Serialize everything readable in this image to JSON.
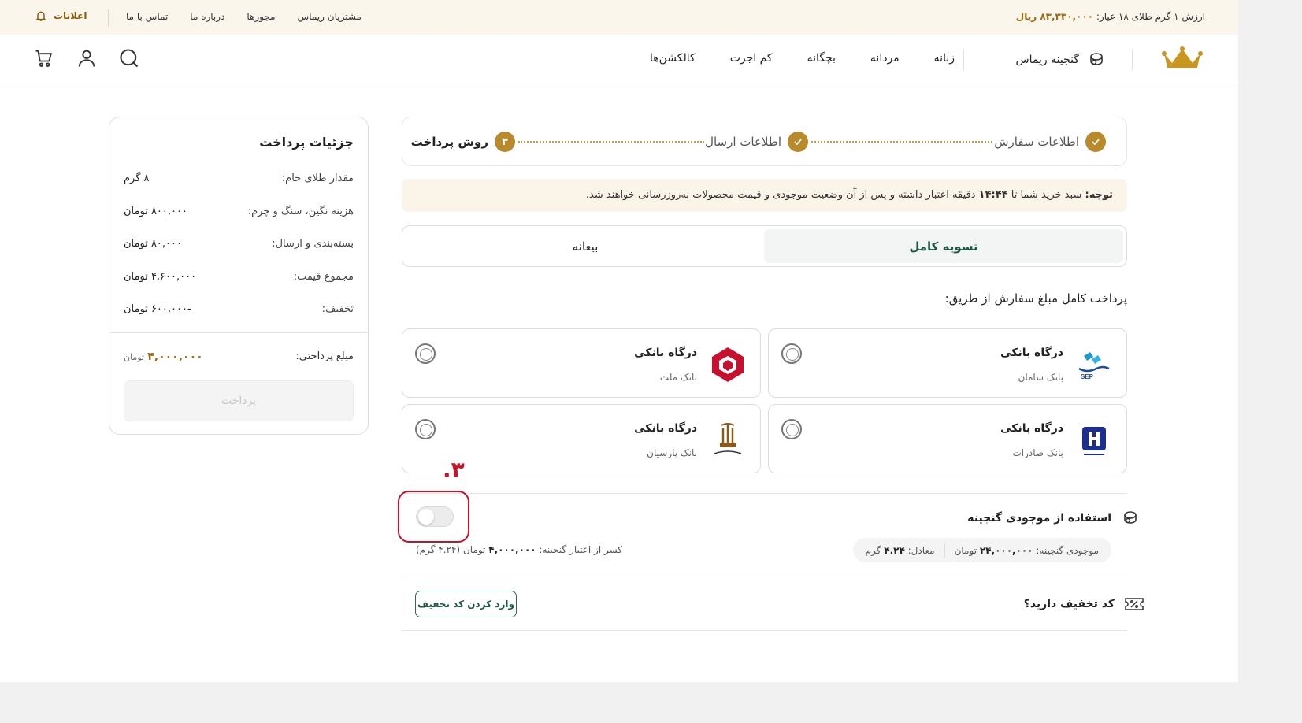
{
  "topbar": {
    "gold_price_label": "ارزش ۱ گرم طلای ۱۸ عیار:",
    "gold_price_value": "۸۳,۳۳۰,۰۰۰ ریال",
    "links": [
      "مشتریان ریماس",
      "مجوزها",
      "درباره ما",
      "تماس با ما"
    ],
    "notifications": "اعلانات"
  },
  "header": {
    "ganjine": "گنجینه ریماس",
    "nav": [
      "زنانه",
      "مردانه",
      "بچگانه",
      "کم اجرت",
      "کالکشن‌ها"
    ]
  },
  "details": {
    "title": "جزئیات پرداخت",
    "rows": [
      {
        "label": "مقدار طلای خام:",
        "value": "۸ گرم"
      },
      {
        "label": "هزینه نگین، سنگ و چرم:",
        "value": "۸۰۰,۰۰۰ تومان"
      },
      {
        "label": "بسته‌بندی و ارسال:",
        "value": "۸۰,۰۰۰ تومان"
      },
      {
        "label": "مجموع قیمت:",
        "value": "۴,۶۰۰,۰۰۰ تومان"
      },
      {
        "label": "تخفیف:",
        "value": "-۶۰۰,۰۰۰ تومان"
      }
    ],
    "total_label": "مبلغ پرداختی:",
    "total_value": "۴,۰۰۰,۰۰۰",
    "total_unit": "تومان",
    "pay_button": "پرداخت"
  },
  "stepper": {
    "steps": [
      "اطلاعات سفارش",
      "اطلاعات ارسال",
      "روش پرداخت"
    ],
    "current_number": "۳"
  },
  "notice": {
    "bold": "توجه:",
    "text": " سبد خرید شما تا ",
    "time": "۱۴:۴۴",
    "rest": " دقیقه اعتبار داشته و پس از آن وضعیت موجودی و قیمت محصولات به‌روزرسانی خواهند شد."
  },
  "tabs": {
    "full": "تسویه کامل",
    "deposit": "بیعانه"
  },
  "via_label": "پرداخت کامل مبلغ سفارش از طریق:",
  "gateways": [
    {
      "title": "درگاه بانکی",
      "bank": "بانک سامان"
    },
    {
      "title": "درگاه بانکی",
      "bank": "بانک ملت"
    },
    {
      "title": "درگاه بانکی",
      "bank": "بانک صادرات"
    },
    {
      "title": "درگاه بانکی",
      "bank": "بانک پارسیان"
    }
  ],
  "wallet": {
    "title": "استفاده از موجودی گنجینه",
    "balance_label": "موجودی گنجینه:",
    "balance_value": "۲۴,۰۰۰,۰۰۰",
    "balance_unit": "تومان",
    "equiv_label": "معادل:",
    "equiv_value": "۴.۲۴",
    "equiv_unit": "گرم",
    "deduct_label": "کسر از اعتبار گنجینه:",
    "deduct_value": "۴,۰۰۰,۰۰۰",
    "deduct_unit": "تومان",
    "deduct_grams": "(۴.۲۴ گرم)",
    "annotation": "۳."
  },
  "discount": {
    "title": "کد تخفیف دارید؟",
    "button": "وارد کردن کد تخفیف"
  }
}
